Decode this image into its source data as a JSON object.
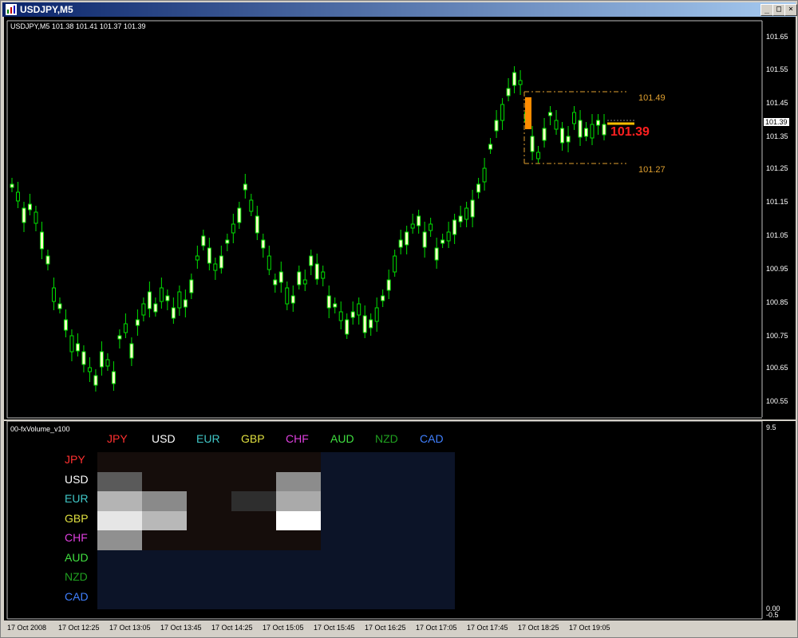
{
  "window": {
    "title": "USDJPY,M5"
  },
  "chart": {
    "header": "USDJPY,M5  101.38 101.41 101.37 101.39",
    "price_levels": [
      "101.65",
      "101.55",
      "101.45",
      "101.35",
      "101.25",
      "101.15",
      "101.05",
      "100.95",
      "100.85",
      "100.75",
      "100.65",
      "100.55"
    ],
    "current_price_tag": "101.39",
    "big_price_label": "101.39",
    "range_high_label": "101.49",
    "range_low_label": "101.27",
    "time_labels": [
      "17 Oct 2008",
      "17 Oct 12:25",
      "17 Oct 13:05",
      "17 Oct 13:45",
      "17 Oct 14:25",
      "17 Oct 15:05",
      "17 Oct 15:45",
      "17 Oct 16:25",
      "17 Oct 17:05",
      "17 Oct 17:45",
      "17 Oct 18:25",
      "17 Oct 19:05"
    ],
    "colors": {
      "candle_up": "#000000",
      "candle_down": "#ffffc8",
      "wick": "#00e000",
      "range_box": "#e0a030",
      "big_price": "#ff2020",
      "highlight_bar": "#ff8c00"
    }
  },
  "chart_data": {
    "type": "candlestick",
    "symbol": "USDJPY",
    "timeframe": "M5",
    "ylim": [
      100.5,
      101.7
    ],
    "x_range": [
      "17 Oct 2008",
      "17 Oct 19:05"
    ],
    "last_close": 101.39,
    "range_high": 101.49,
    "range_low": 101.27
  },
  "indicator": {
    "name": "00-fxVolume_v100",
    "scale_top": "9.5",
    "scale_bottom_1": "0.00",
    "scale_bottom_2": "-0.5",
    "columns": [
      {
        "label": "JPY",
        "color": "#ff3030"
      },
      {
        "label": "USD",
        "color": "#ffffff"
      },
      {
        "label": "EUR",
        "color": "#40c8c8"
      },
      {
        "label": "GBP",
        "color": "#e0e040"
      },
      {
        "label": "CHF",
        "color": "#e040e0"
      },
      {
        "label": "AUD",
        "color": "#40e040"
      },
      {
        "label": "NZD",
        "color": "#20a020"
      },
      {
        "label": "CAD",
        "color": "#4080ff"
      }
    ],
    "rows": [
      {
        "label": "JPY",
        "color": "#ff3030"
      },
      {
        "label": "USD",
        "color": "#ffffff"
      },
      {
        "label": "EUR",
        "color": "#40c8c8"
      },
      {
        "label": "GBP",
        "color": "#e0e040"
      },
      {
        "label": "CHF",
        "color": "#e040e0"
      },
      {
        "label": "AUD",
        "color": "#40e040"
      },
      {
        "label": "NZD",
        "color": "#20a020"
      },
      {
        "label": "CAD",
        "color": "#4080ff"
      }
    ],
    "matrix": [
      [
        "#150d0b",
        "#150d0b",
        "#150d0b",
        "#150d0b",
        "#150d0b",
        "#0c1428",
        "#0c1428",
        "#0c1428"
      ],
      [
        "#5a5a5a",
        "#150d0b",
        "#150d0b",
        "#150d0b",
        "#8c8c8c",
        "#0c1428",
        "#0c1428",
        "#0c1428"
      ],
      [
        "#b4b4b4",
        "#8a8a8a",
        "#150d0b",
        "#2e2e2e",
        "#aaaaaa",
        "#0c1428",
        "#0c1428",
        "#0c1428"
      ],
      [
        "#e6e6e6",
        "#b8b8b8",
        "#150d0b",
        "#150d0b",
        "#ffffff",
        "#0c1428",
        "#0c1428",
        "#0c1428"
      ],
      [
        "#909090",
        "#150d0b",
        "#150d0b",
        "#150d0b",
        "#150d0b",
        "#0c1428",
        "#0c1428",
        "#0c1428"
      ],
      [
        "#0c1428",
        "#0c1428",
        "#0c1428",
        "#0c1428",
        "#0c1428",
        "#0c1428",
        "#0c1428",
        "#0c1428"
      ],
      [
        "#0c1428",
        "#0c1428",
        "#0c1428",
        "#0c1428",
        "#0c1428",
        "#0c1428",
        "#0c1428",
        "#0c1428"
      ],
      [
        "#0c1428",
        "#0c1428",
        "#0c1428",
        "#0c1428",
        "#0c1428",
        "#0c1428",
        "#0c1428",
        "#0c1428"
      ]
    ]
  }
}
